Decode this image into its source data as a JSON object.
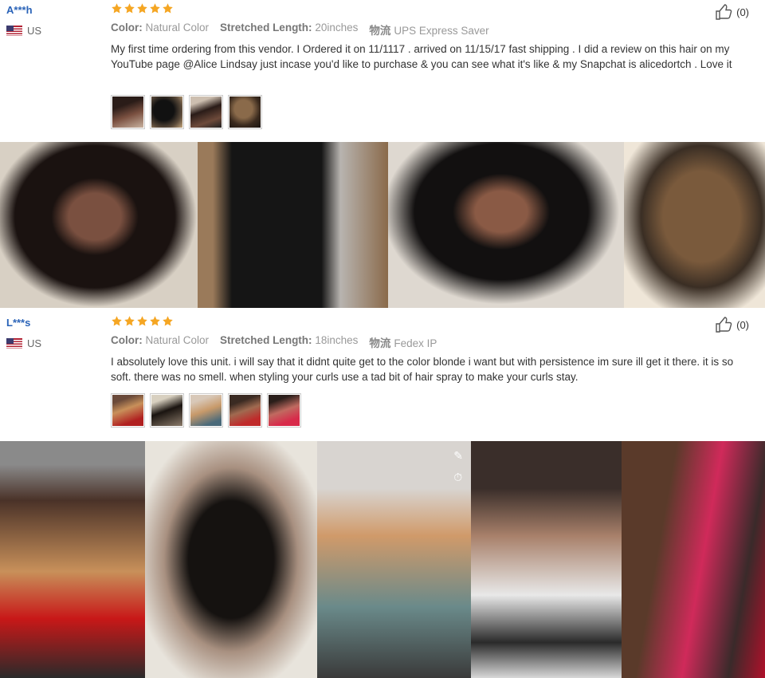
{
  "reviews": [
    {
      "user": "A***h",
      "country": "US",
      "rating": 5,
      "color_label": "Color:",
      "color_value": "Natural Color",
      "length_label": "Stretched Length:",
      "length_value": "20inches",
      "shipping_label": "物流",
      "shipping_value": "UPS Express Saver",
      "text": "My first time ordering from this vendor. I Ordered it on 11/1117 . arrived on 11/15/17 fast shipping . I did a review on this hair on my YouTube page @Alice Lindsay just incase you'd like to purchase & you can see what it's like & my Snapchat is alicedortch . Love it",
      "likes": "(0)"
    },
    {
      "user": "L***s",
      "country": "US",
      "rating": 5,
      "color_label": "Color:",
      "color_value": "Natural Color",
      "length_label": "Stretched Length:",
      "length_value": "18inches",
      "shipping_label": "物流",
      "shipping_value": "Fedex IP",
      "text": "I absolutely love this unit. i will say that it didnt quite get to the color blonde i want but with persistence im sure ill get it there. it is so soft. there was no smell. when styling your curls use a tad bit of hair spray to make your curls stay.",
      "likes": "(0)"
    }
  ],
  "icons": {
    "star": "star-icon",
    "like": "thumbs-up-icon",
    "flag": "us-flag-icon"
  },
  "colors": {
    "star": "#f5a623",
    "username": "#2a63b8"
  }
}
